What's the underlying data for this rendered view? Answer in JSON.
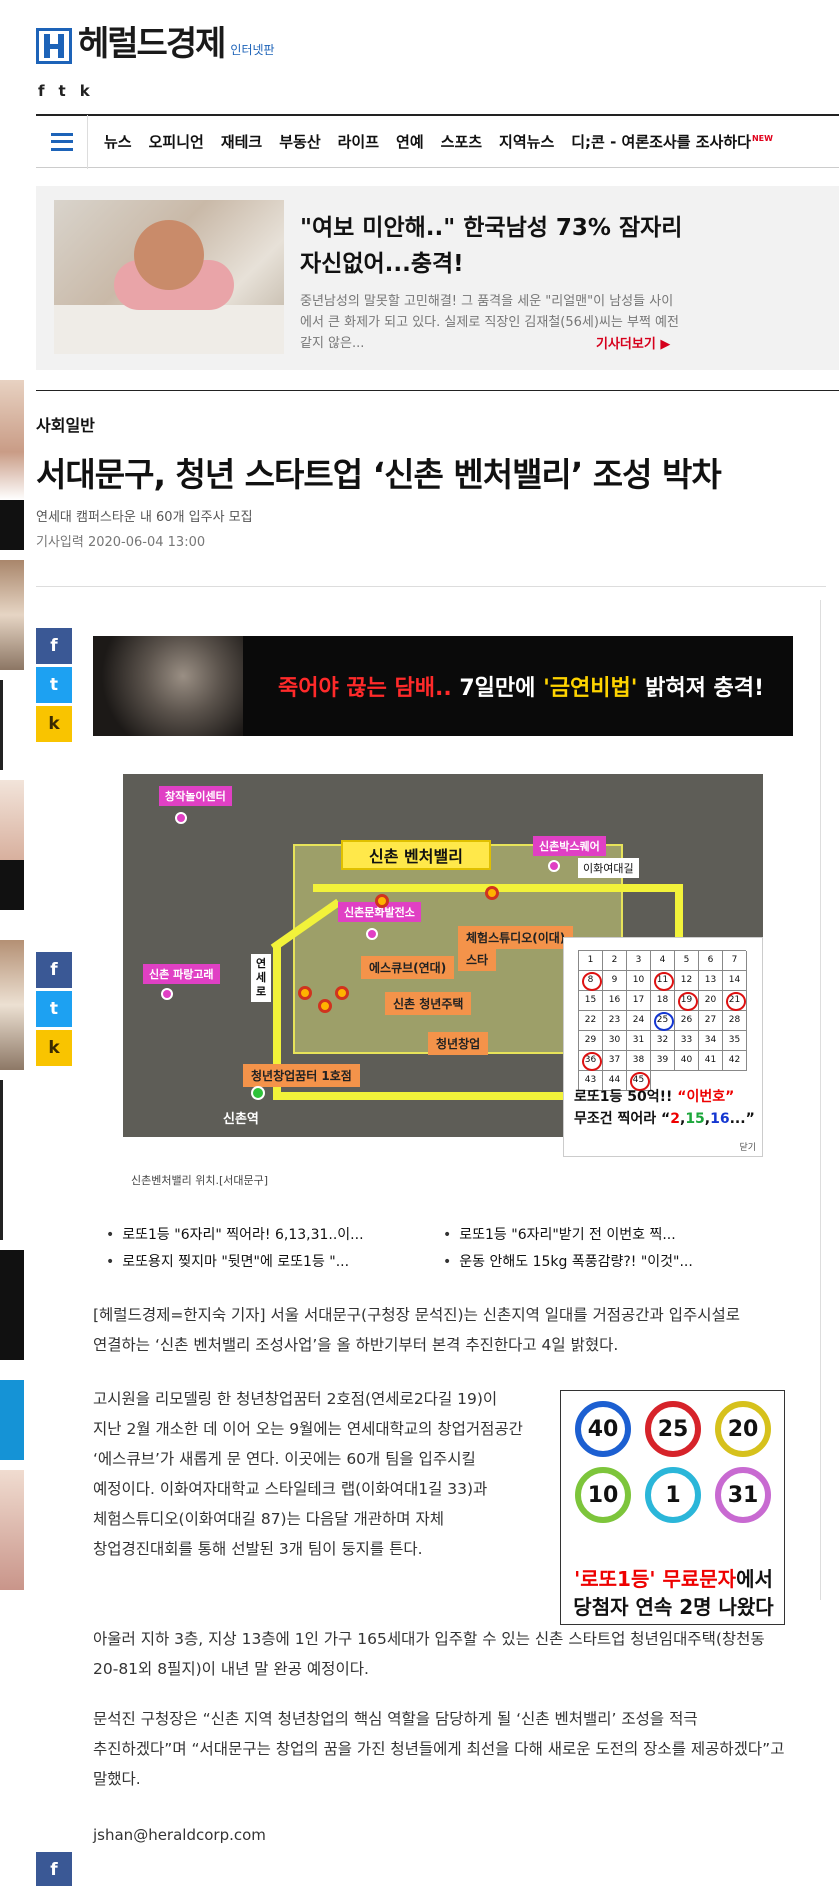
{
  "header": {
    "logo_text": "헤럴드경제",
    "logo_sub": "인터넷판",
    "social": [
      "f",
      "t",
      "k"
    ]
  },
  "nav": {
    "items": [
      "뉴스",
      "오피니언",
      "재테크",
      "부동산",
      "라이프",
      "연예",
      "스포츠",
      "지역뉴스",
      "디;콘 - 여론조사를 조사하다"
    ],
    "new_badge": "NEW"
  },
  "promo": {
    "title": "\"여보 미안해..\" 한국남성 73% 잠자리 자신없어...충격!",
    "desc": "중년남성의 말못할 고민해결! 그 품격을 세운 \"리얼맨\"이 남성들 사이에서 큰 화제가 되고 있다. 실제로 직장인 김재철(56세)씨는 부쩍 예전같지 않은...",
    "more": "기사더보기 ▶"
  },
  "article": {
    "category": "사회일반",
    "headline": "서대문구, 청년 스타트업 ‘신촌 벤처밸리’ 조성 박차",
    "subhead": "연세대 캠퍼스타운 내 60개 입주사 모집",
    "dateline": "기사입력 2020-06-04 13:00",
    "caption": "신촌벤처밸리 위치.[서대문구]",
    "paragraphs": [
      "[헤럴드경제=한지숙 기자] 서울 서대문구(구청장 문석진)는 신촌지역 일대를 거점공간과 입주시설로 연결하는 ‘신촌 벤처밸리 조성사업’을 올 하반기부터 본격 추진한다고 4일 밝혔다.",
      "고시원을 리모델링 한 청년창업꿈터 2호점(연세로2다길 19)이 지난 2월 개소한 데 이어 오는 9월에는 연세대학교의 창업거점공간 ‘에스큐브’가 새롭게 문 연다. 이곳에는 60개 팀을 입주시킬 예정이다. 이화여자대학교 스타일테크 랩(이화여대1길 33)과 체험스튜디오(이화여대길 87)는 다음달 개관하며 자체 창업경진대회를 통해 선발된 3개 팀이 둥지를 튼다.",
      "아울러 지하 3층, 지상 13층에 1인 가구 165세대가 입주할 수 있는 신촌 스타트업 청년임대주택(창천동 20-81외 8필지)이 내년 말 완공 예정이다.",
      "문석진 구청장은 “신촌 지역 청년창업의 핵심 역할을 담당하게 될 ‘신촌 벤처밸리’ 조성을 적극 추진하겠다”며 “서대문구는 창업의 꿈을 가진 청년들에게 최선을 다해 새로운 도전의 장소를 제공하겠다”고 말했다."
    ],
    "email": "jshan@heraldcorp.com"
  },
  "share": [
    "f",
    "t",
    "k"
  ],
  "ad_banner": {
    "red": "죽어야 끊는 담배..",
    "white1": " 7일만에 ",
    "yellow": "'금연비법'",
    "white2": " 밝혀져 충격!"
  },
  "map": {
    "title": "신촌 벤처밸리",
    "tags": [
      "창작놀이센터",
      "신촌박스퀘어",
      "신촌문화발전소",
      "신촌 파랑고래"
    ],
    "orgs": [
      "체험스튜디오(이대)",
      "스타",
      "에스큐브(연대)",
      "신촌 청년주택",
      "청년창업",
      "청년창업꿈터 1호점"
    ],
    "road_top": "이화여대길",
    "road_vert": "연세로",
    "station": "신촌역"
  },
  "lotto_ad": {
    "numbers": [
      1,
      2,
      3,
      4,
      5,
      6,
      7,
      8,
      9,
      10,
      11,
      12,
      13,
      14,
      15,
      16,
      17,
      18,
      19,
      20,
      21,
      22,
      23,
      24,
      25,
      26,
      27,
      28,
      29,
      30,
      31,
      32,
      33,
      34,
      35,
      36,
      37,
      38,
      39,
      40,
      41,
      42,
      43,
      44,
      45
    ],
    "marked_red": [
      8,
      11,
      19,
      21,
      36,
      45
    ],
    "marked_blue": [
      25
    ],
    "line1_a": "로또1등 50억!! ",
    "line1_b": "“이번호”",
    "line2_a": "무조건 찍어라 “",
    "line2_n1": "2",
    "line2_n2": "15",
    "line2_n3": "16",
    "line2_end": "...”",
    "close": "닫기"
  },
  "related": [
    "로또1등 \"6자리\" 찍어라! 6,13,31..이...",
    "로또1등 \"6자리\"받기 전 이번호 찍...",
    "로또용지 찢지마 \"뒷면\"에 로또1등 \"...",
    "운동 안해도 15kg 폭풍감량?! \"이것\"..."
  ],
  "balls_ad": {
    "balls": [
      {
        "n": "40",
        "color": "#1c5fd1"
      },
      {
        "n": "25",
        "color": "#d6232a"
      },
      {
        "n": "20",
        "color": "#d6c11c"
      },
      {
        "n": "10",
        "color": "#7dc53b"
      },
      {
        "n": "1",
        "color": "#2bb6d9"
      },
      {
        "n": "31",
        "color": "#c86ad1"
      }
    ],
    "line1_red": "'로또1등' 무료문자",
    "line1_black": "에서",
    "line2": "당첨자 연속 2명 나왔다"
  },
  "colors": {
    "brand": "#1d63b8",
    "accent_red": "#d6001c",
    "facebook": "#3a5895",
    "twitter": "#1da1f2",
    "kakao": "#f9c400"
  }
}
